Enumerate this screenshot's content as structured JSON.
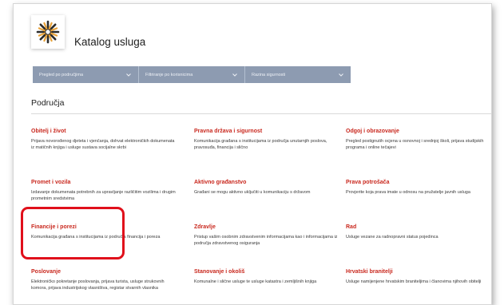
{
  "header": {
    "title": "Katalog usluga"
  },
  "filters": [
    {
      "label": "Pregled po područjima",
      "icon": "chevron-down-icon"
    },
    {
      "label": "Filtriranje po korisnicima",
      "icon": "chevron-down-icon"
    },
    {
      "label": "Razina sigurnosti",
      "icon": "chevron-down-icon"
    }
  ],
  "section": {
    "title": "Područja"
  },
  "categories": [
    {
      "title": "Obitelj i život",
      "description": "Prijava novorođenog djeteta i vjenčanja, dohvat elektroničkih dokumenata iz matičnih knjiga i usluge sustava socijalne skrbi"
    },
    {
      "title": "Pravna država i sigurnost",
      "description": "Komunikacija građana s institucijama iz područja unutarnjih poslova, pravosuđa, financija i slično"
    },
    {
      "title": "Odgoj i obrazovanje",
      "description": "Pregled postignutih ocjena u osnovnoj i srednjoj školi, prijava studijskih programa i online tečajevi"
    },
    {
      "title": "Promet i vozila",
      "description": "Izdavanje dokumenata potrebnih za upravljanje različitim vozilima i drugim prometnim sredstvima"
    },
    {
      "title": "Aktivno građanstvo",
      "description": "Građani se mogu aktivno uključiti u komunikaciju s državom"
    },
    {
      "title": "Prava potrošača",
      "description": "Provjerite koja prava imate u odnosu na pružatelje javnih usluga"
    },
    {
      "title": "Financije i porezi",
      "description": "Komunikacija građana s institucijama iz područja financija i poreza"
    },
    {
      "title": "Zdravlje",
      "description": "Pristup vašim osobnim zdravstvenim informacijama kao i informacijama iz područja zdravstvenog osiguranja"
    },
    {
      "title": "Rad",
      "description": "Usluge vezane za radnopravni status pojedinca"
    },
    {
      "title": "Poslovanje",
      "description": "Elektroničko pokretanje poslovanja, prijava turista, usluge strukovnih komora, prijava industrijskog vlasništva, registar stvarnih vlasnika"
    },
    {
      "title": "Stanovanje i okoliš",
      "description": "Komunalne i slične usluge te usluge katastra i zemljišnih knjiga"
    },
    {
      "title": "Hrvatski branitelji",
      "description": "Usluge namijenjene hrvatskim braniteljima i članovima njihovih obitelji"
    }
  ],
  "colors": {
    "accent": "#c9281e",
    "filter_bar": "#8d9bb1",
    "highlight": "#e0101b"
  }
}
